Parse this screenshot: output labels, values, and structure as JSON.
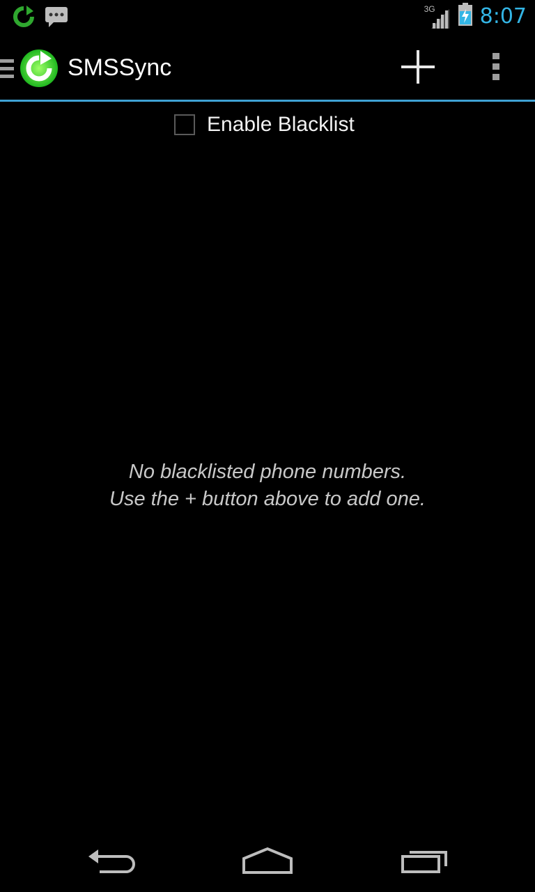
{
  "status_bar": {
    "time": "8:07",
    "network": "3G",
    "notification_icons": [
      "smssync-icon",
      "message-icon"
    ],
    "accent_color": "#33b5e5"
  },
  "action_bar": {
    "title": "SMSSync",
    "actions": [
      "add-icon",
      "overflow-menu-icon"
    ],
    "accent_color": "#3fa2d4"
  },
  "blacklist": {
    "toggle_label": "Enable Blacklist",
    "enabled": false
  },
  "empty_state": {
    "line1": "No blacklisted phone numbers.",
    "line2": "Use the + button above to add one."
  },
  "nav_bar": {
    "buttons": [
      "back-icon",
      "home-icon",
      "recent-apps-icon"
    ]
  }
}
